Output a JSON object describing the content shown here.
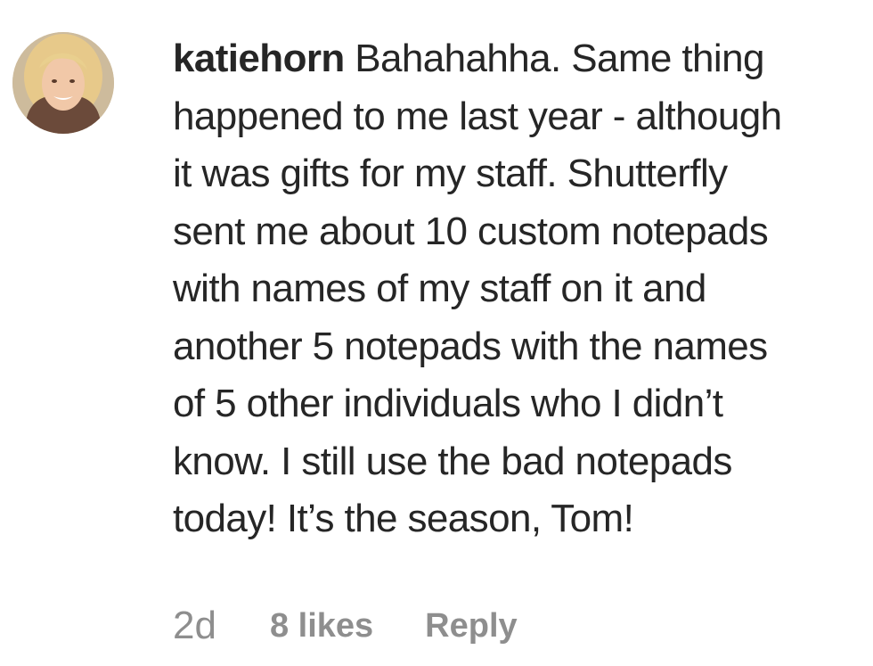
{
  "comment": {
    "username": "katiehorn",
    "text_lines": [
      "Bahahahha. Same thing",
      "happened to me last year - although",
      "it was gifts for my staff. Shutterfly",
      "sent me about 10 custom notepads",
      "with names of my staff on it and",
      "another 5 notepads with the names",
      "of 5 other individuals who I didn’t",
      "know. I still use the bad notepads",
      "today! It’s the season, Tom!"
    ],
    "timestamp": "2d",
    "likes": "8 likes",
    "reply_label": "Reply"
  },
  "colors": {
    "text": "#262626",
    "meta": "#8e8e8e",
    "background": "#ffffff"
  }
}
